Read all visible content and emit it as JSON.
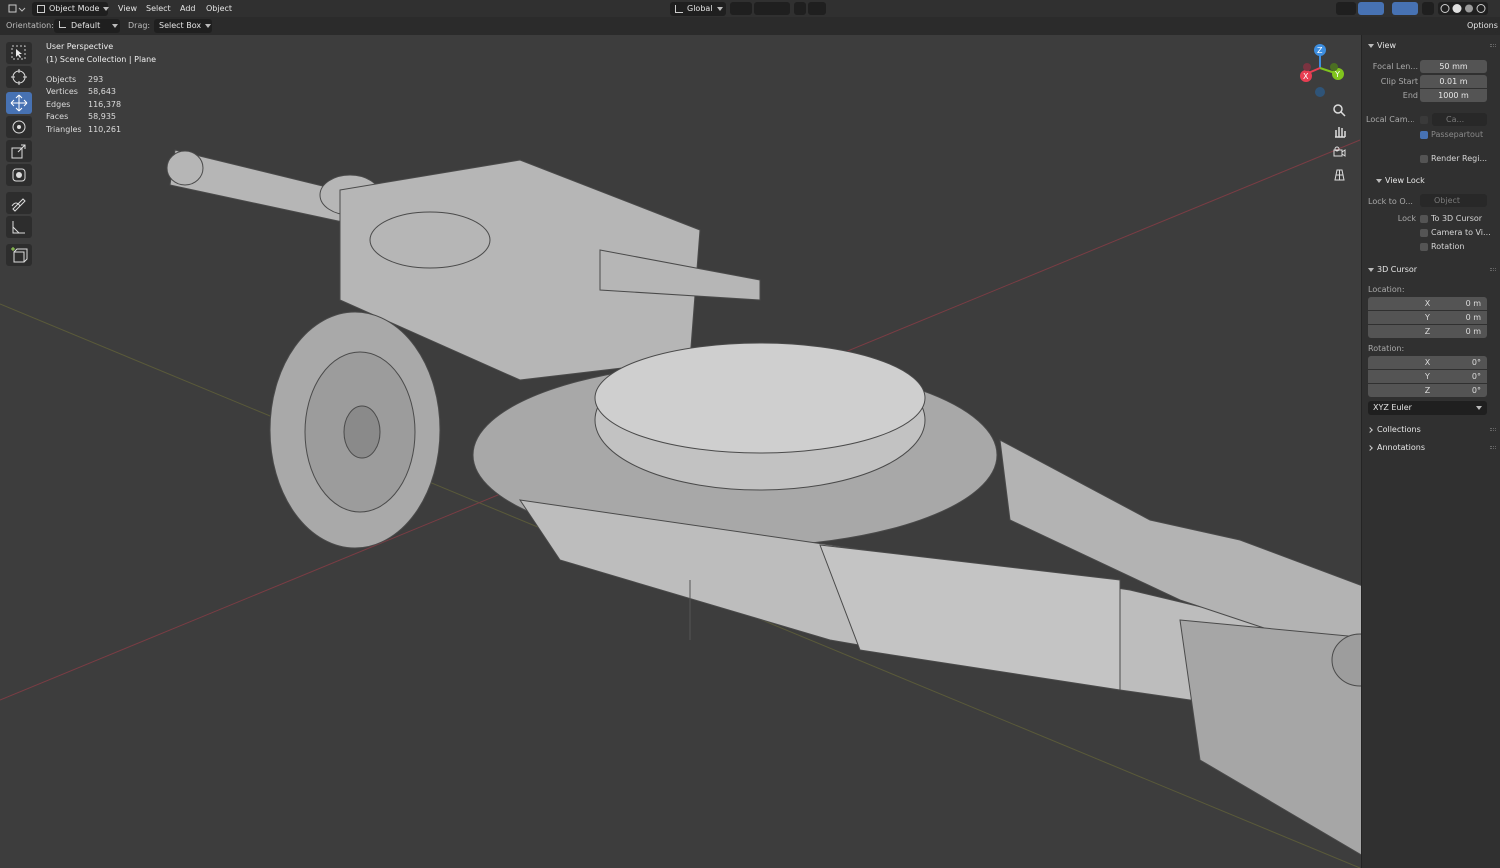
{
  "header": {
    "mode": "Object Mode",
    "menus": [
      "View",
      "Select",
      "Add",
      "Object"
    ],
    "transform_orientation": "Global",
    "options_label": "Options"
  },
  "tool_settings": {
    "orientation_label": "Orientation:",
    "orientation_value": "Default",
    "drag_label": "Drag:",
    "drag_value": "Select Box"
  },
  "overlay": {
    "view_name": "User Perspective",
    "collection": "(1) Scene Collection | Plane",
    "stats": [
      {
        "label": "Objects",
        "value": "293"
      },
      {
        "label": "Vertices",
        "value": "58,643"
      },
      {
        "label": "Edges",
        "value": "116,378"
      },
      {
        "label": "Faces",
        "value": "58,935"
      },
      {
        "label": "Triangles",
        "value": "110,261"
      }
    ]
  },
  "gizmo": {
    "axes": [
      "Z",
      "X",
      "Y"
    ],
    "colors": {
      "x": "#e83e52",
      "y": "#80c41d",
      "z": "#3d8ee0"
    }
  },
  "sidebar": {
    "view": {
      "title": "View",
      "focal_label": "Focal Len...",
      "focal_value": "50 mm",
      "clip_start_label": "Clip Start",
      "clip_start_value": "0.01 m",
      "clip_end_label": "End",
      "clip_end_value": "1000 m",
      "local_cam_label": "Local Cam...",
      "local_cam_value": "Ca...",
      "passepartout_label": "Passepartout",
      "render_region_label": "Render Regi..."
    },
    "view_lock": {
      "title": "View Lock",
      "lock_to_label": "Lock to O...",
      "lock_to_placeholder": "Object",
      "lock_label": "Lock",
      "to_3d_cursor": "To 3D Cursor",
      "camera_to_view": "Camera to Vi...",
      "rotation": "Rotation"
    },
    "cursor": {
      "title": "3D Cursor",
      "location_label": "Location:",
      "location": [
        {
          "axis": "X",
          "value": "0 m"
        },
        {
          "axis": "Y",
          "value": "0 m"
        },
        {
          "axis": "Z",
          "value": "0 m"
        }
      ],
      "rotation_label": "Rotation:",
      "rotation": [
        {
          "axis": "X",
          "value": "0°"
        },
        {
          "axis": "Y",
          "value": "0°"
        },
        {
          "axis": "Z",
          "value": "0°"
        }
      ],
      "rotation_mode": "XYZ Euler"
    },
    "collections_title": "Collections",
    "annotations_title": "Annotations"
  },
  "colors": {
    "accent": "#4772b3",
    "viewport_bg": "#3d3d3d",
    "mesh": "#b9b9b9"
  }
}
